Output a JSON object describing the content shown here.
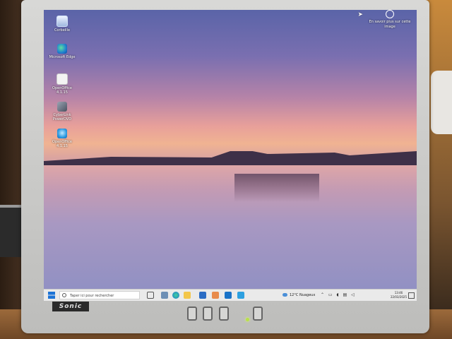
{
  "desktop": {
    "icons": [
      {
        "label": "Corbeille",
        "icon": "recycle-bin-icon"
      },
      {
        "label": "Microsoft Edge",
        "icon": "edge-icon"
      },
      {
        "label": "OpenOffice 4.1.15",
        "icon": "document-icon"
      },
      {
        "label": "CyberLink PowerDVD",
        "icon": "app-icon"
      },
      {
        "label": "OpenOffice 4.1.15",
        "icon": "openoffice-icon"
      }
    ],
    "spotlight_text": "En savoir plus sur cette image"
  },
  "taskbar": {
    "search_placeholder": "Taper ici pour rechercher",
    "weather": "12°C  Nuageux",
    "time": "13:46",
    "date": "22/03/2025",
    "apps": [
      "task-view-icon",
      "widgets-icon",
      "edge-icon",
      "file-explorer-icon",
      "store-icon",
      "mail-icon",
      "outlook-icon",
      "app-icon"
    ]
  },
  "monitor": {
    "brand": "Sonic"
  },
  "colors": {
    "taskbar_bg": "#eaeaea",
    "accent": "#1c73d6"
  }
}
